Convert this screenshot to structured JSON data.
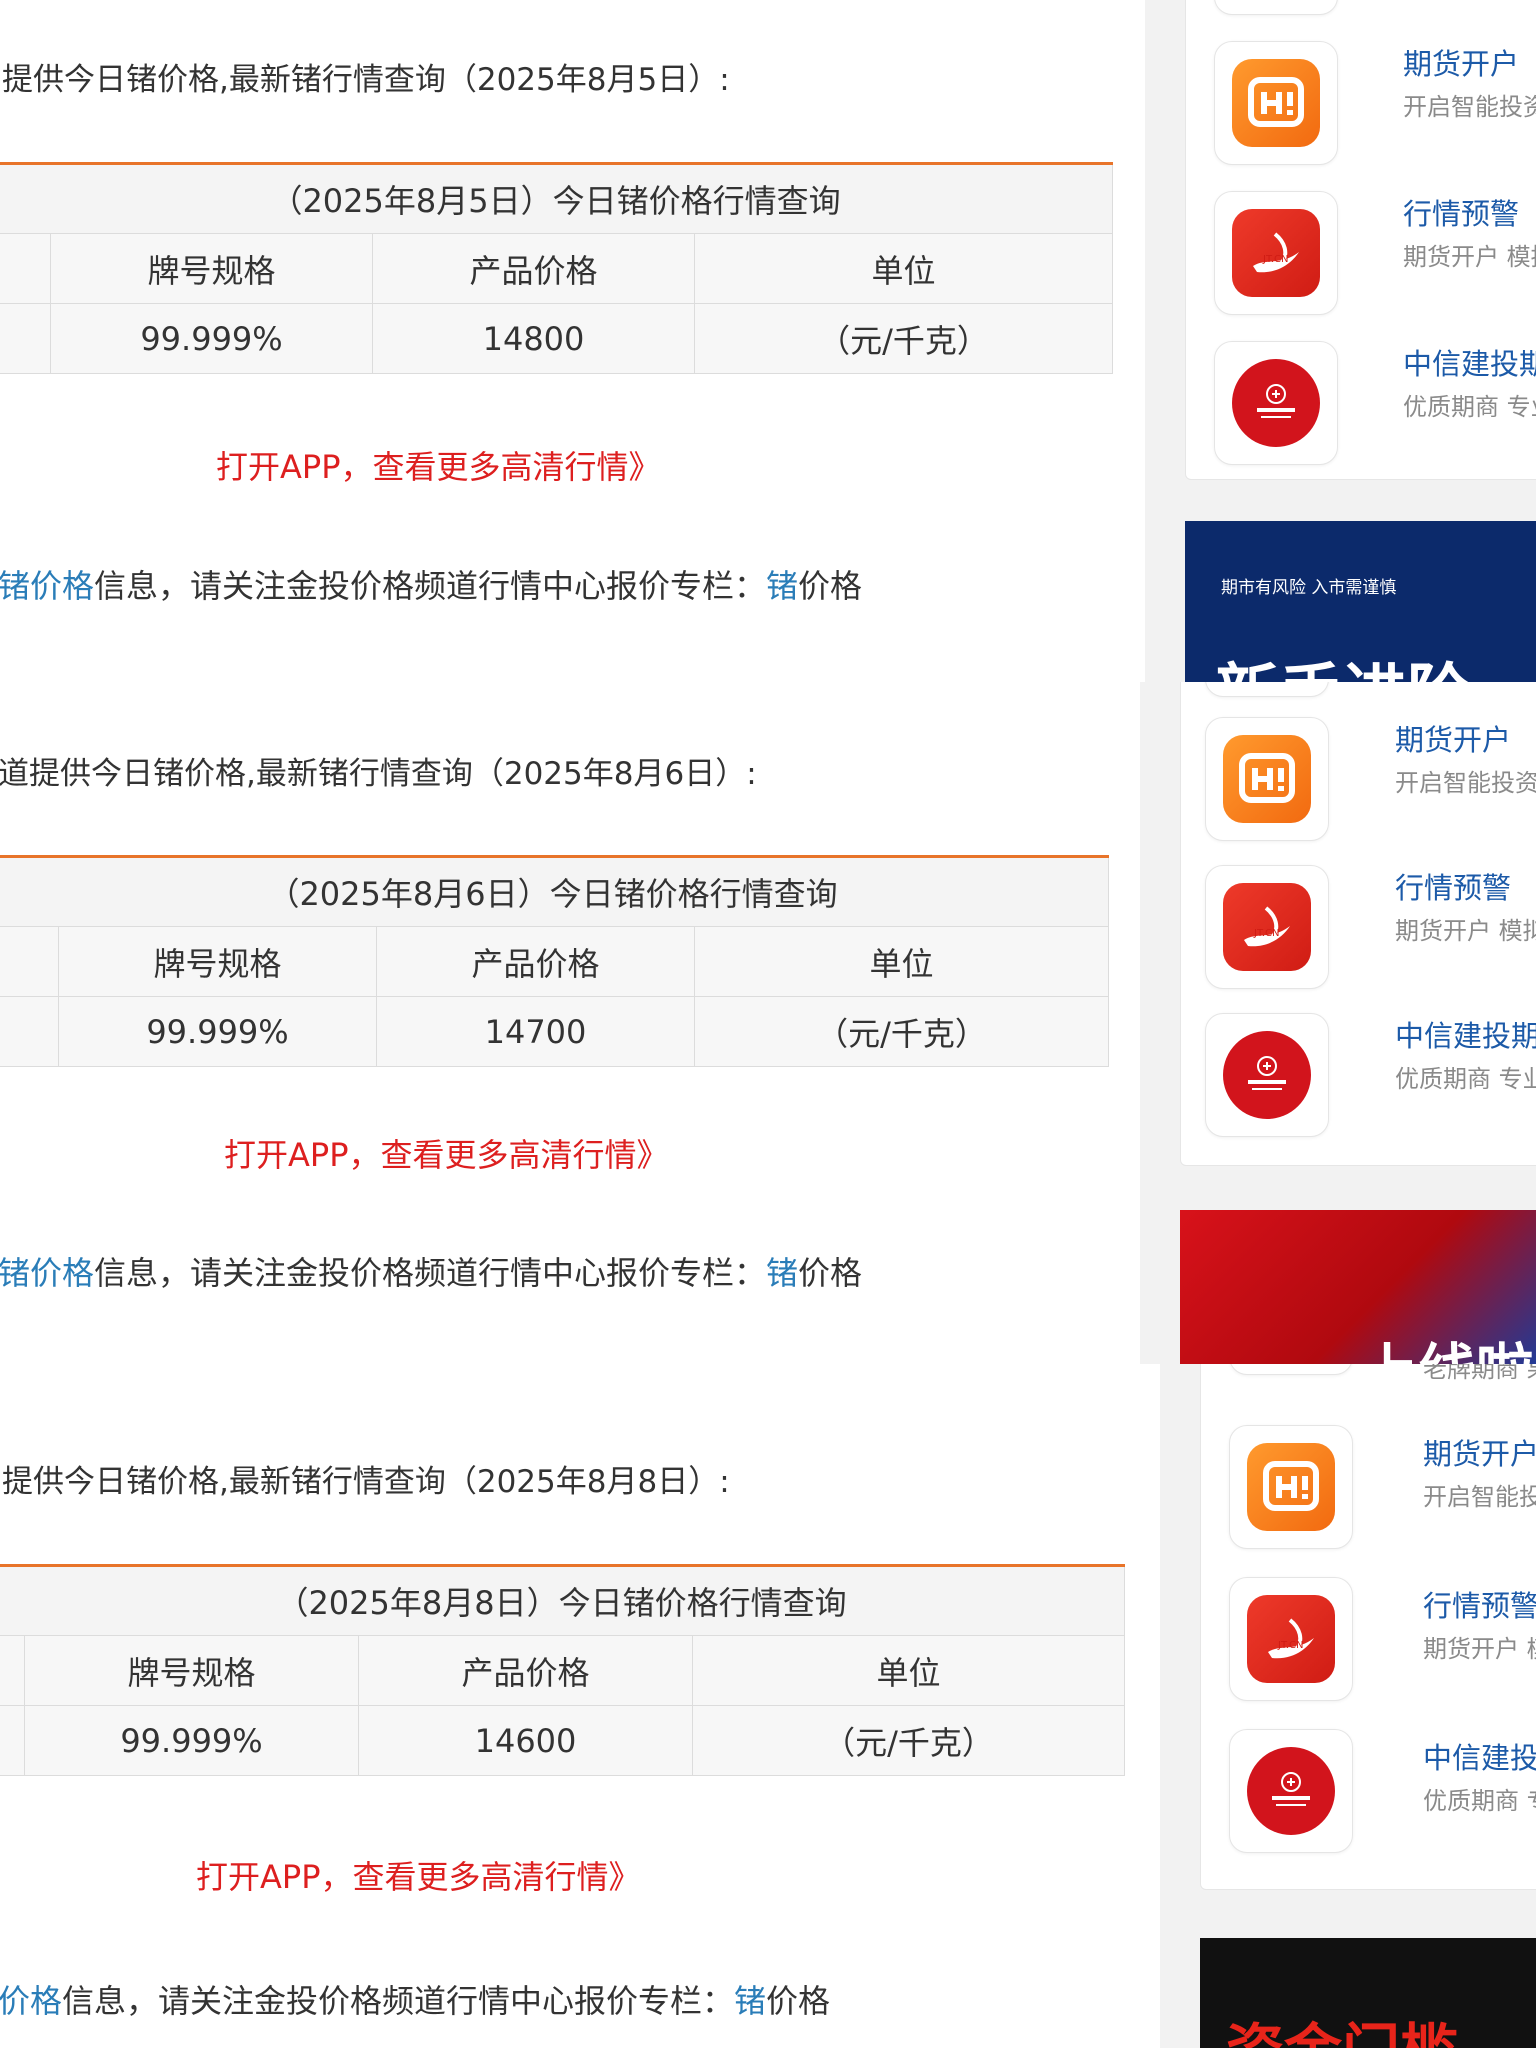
{
  "sections": [
    {
      "intro": "提供今日锗价格,最新锗行情查询（2025年8月5日）:",
      "table": {
        "caption": "（2025年8月5日）今日锗价格行情查询",
        "headers": [
          "牌号规格",
          "产品价格",
          "单位"
        ],
        "row": [
          "99.999%",
          "14800",
          "（元/千克）"
        ]
      },
      "app_link": "打开APP，查看更多高清行情》",
      "follow": {
        "link_prefix": "锗价格",
        "text": "信息，请关注金投价格频道行情中心报价专栏：",
        "link_char": "锗",
        "tail": "价格"
      },
      "sidebar": {
        "items": [
          {
            "title": "期货开户",
            "subtitle": "开启智能投资之",
            "icon": "futures-h-icon"
          },
          {
            "title": "行情预警",
            "subtitle": "期货开户 模拟交",
            "icon": "jtcn-icon"
          },
          {
            "title": "中信建投期货",
            "subtitle": "优质期商 专业服",
            "icon": "china-futures-icon"
          }
        ],
        "banner_text": "期市有风险 入市需谨慎",
        "banner_headline": "新手进阶"
      }
    },
    {
      "intro": "道提供今日锗价格,最新锗行情查询（2025年8月6日）:",
      "table": {
        "caption": "（2025年8月6日）今日锗价格行情查询",
        "headers": [
          "牌号规格",
          "产品价格",
          "单位"
        ],
        "row": [
          "99.999%",
          "14700",
          "（元/千克）"
        ]
      },
      "app_link": "打开APP，查看更多高清行情》",
      "follow": {
        "link_prefix": "锗价格",
        "text": "信息，请关注金投价格频道行情中心报价专栏：",
        "link_char": "锗",
        "tail": "价格"
      },
      "sidebar": {
        "items": [
          {
            "title": "期货开户",
            "subtitle": "开启智能投资之",
            "icon": "futures-h-icon"
          },
          {
            "title": "行情预警",
            "subtitle": "期货开户 模拟交",
            "icon": "jtcn-icon"
          },
          {
            "title": "中信建投期货",
            "subtitle": "优质期商 专业服",
            "icon": "china-futures-icon"
          }
        ],
        "banner_headline": "上线啦"
      }
    },
    {
      "intro": "提供今日锗价格,最新锗行情查询（2025年8月8日）:",
      "table": {
        "caption": "（2025年8月8日）今日锗价格行情查询",
        "headers": [
          "牌号规格",
          "产品价格",
          "单位"
        ],
        "row": [
          "99.999%",
          "14600",
          "（元/千克）"
        ]
      },
      "app_link": "打开APP，查看更多高清行情》",
      "follow": {
        "link_prefix": "价格",
        "text": "信息，请关注金投价格频道行情中心报价专栏：",
        "link_char": "锗",
        "tail": "价格"
      },
      "sidebar": {
        "top_sub": "老牌期商 果",
        "items": [
          {
            "title": "期货开户",
            "subtitle": "开启智能投资",
            "icon": "futures-h-icon"
          },
          {
            "title": "行情预警",
            "subtitle": "期货开户 模拟",
            "icon": "jtcn-icon"
          },
          {
            "title": "中信建投期",
            "subtitle": "优质期商 专业",
            "icon": "china-futures-icon"
          }
        ],
        "banner_headline": "资金门槛"
      }
    }
  ],
  "colors": {
    "accent_orange": "#e8742a",
    "link_red": "#dd1f1f",
    "link_blue": "#2a7db8",
    "side_title_blue": "#1c5aa8"
  }
}
